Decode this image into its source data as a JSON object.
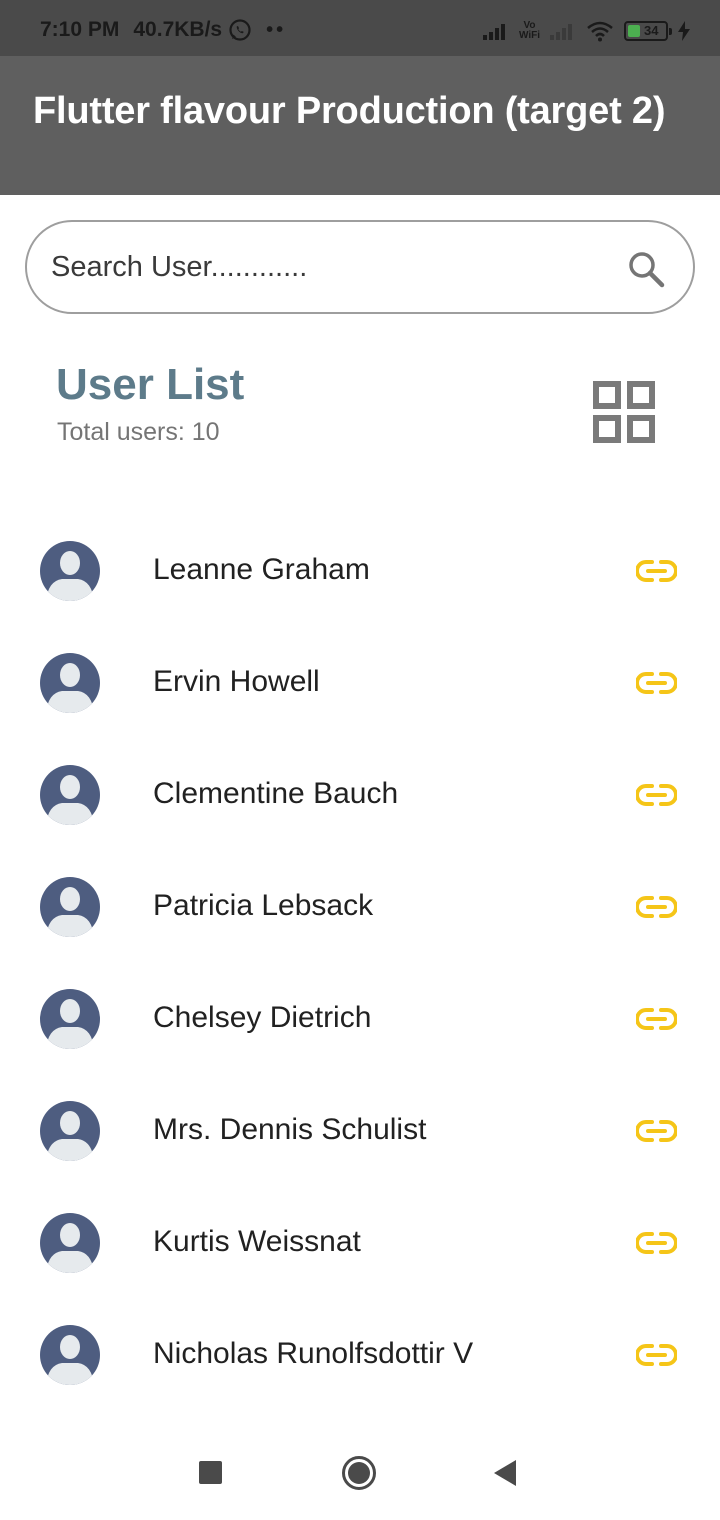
{
  "status_bar": {
    "time": "7:10 PM",
    "speed": "40.7KB/s",
    "extra": "••",
    "vowifi_line1": "Vo",
    "vowifi_line2": "WiFi",
    "battery": "34"
  },
  "app_bar": {
    "title": "Flutter flavour Production (target 2)"
  },
  "search": {
    "placeholder": "Search User............",
    "value": ""
  },
  "list_header": {
    "title": "User List",
    "subtitle": "Total users: 10"
  },
  "users": [
    {
      "name": "Leanne Graham"
    },
    {
      "name": "Ervin Howell"
    },
    {
      "name": "Clementine Bauch"
    },
    {
      "name": "Patricia Lebsack"
    },
    {
      "name": "Chelsey Dietrich"
    },
    {
      "name": "Mrs. Dennis Schulist"
    },
    {
      "name": "Kurtis Weissnat"
    },
    {
      "name": "Nicholas Runolfsdottir V"
    }
  ],
  "icons": {
    "search": "search-icon",
    "grid_view": "grid-view-icon",
    "avatar": "person-avatar-icon",
    "link": "link-icon",
    "nav_recent": "square-icon",
    "nav_home": "circle-icon",
    "nav_back": "triangle-back-icon"
  },
  "colors": {
    "status_bar": "#4a4a4a",
    "app_bar": "#5f5f5f",
    "title_accent": "#5d7b8a",
    "link_accent": "#f5c518",
    "avatar_bg": "#4e5d80"
  }
}
